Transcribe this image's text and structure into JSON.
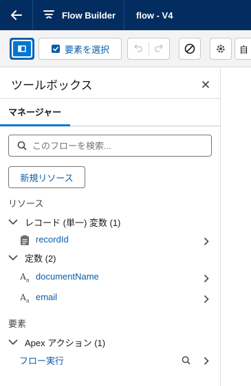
{
  "header": {
    "app_name": "Flow Builder",
    "flow_title": "flow - V4"
  },
  "toolbar": {
    "select_elements_label": "要素を選択",
    "auto_label": "自"
  },
  "panel": {
    "title": "ツールボックス",
    "tabs": [
      {
        "label": "マネージャー",
        "active": true
      }
    ],
    "search_placeholder": "このフローを検索...",
    "new_resource_label": "新規リソース",
    "resources_heading": "リソース",
    "elements_heading": "要素",
    "groups": {
      "record_variables": "レコード (単一) 変数 (1)",
      "constants": "定数 (2)",
      "apex_actions": "Apex アクション (1)"
    },
    "items": {
      "recordId": "recordId",
      "documentName": "documentName",
      "email": "email",
      "flow_execute": "フロー実行"
    }
  },
  "colors": {
    "header_bg": "#032d60",
    "accent": "#0176d3",
    "link": "#0b5cab"
  }
}
